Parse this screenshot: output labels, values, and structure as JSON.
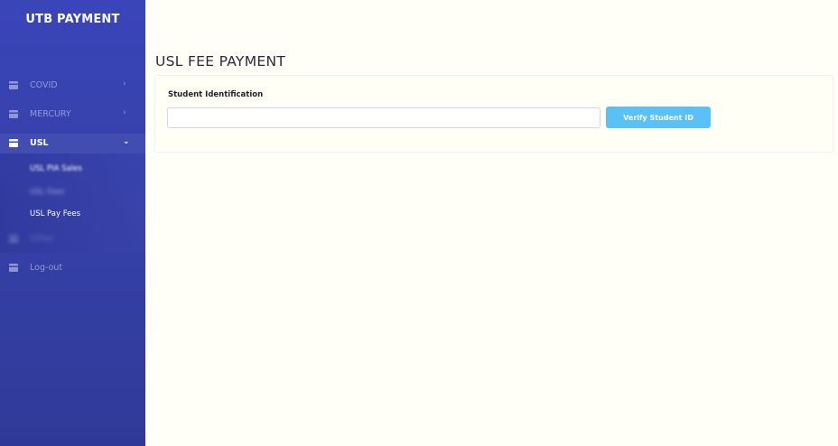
{
  "app": {
    "brand": "UTB PAYMENT"
  },
  "sidebar": {
    "items": [
      {
        "label": "COVID",
        "chevron": "›",
        "icon": "credit-card-icon"
      },
      {
        "label": "MERCURY",
        "chevron": "›",
        "icon": "credit-card-icon"
      },
      {
        "label": "USL",
        "chevron": "⌄",
        "icon": "credit-card-icon"
      },
      {
        "label": "Other",
        "icon": "credit-card-icon"
      },
      {
        "label": "Log-out",
        "icon": "credit-card-icon"
      }
    ],
    "submenu": [
      {
        "label": "USL PIA Sales"
      },
      {
        "label": "USL Fees"
      },
      {
        "label": "USL Pay Fees"
      }
    ]
  },
  "main": {
    "title": "USL FEE PAYMENT",
    "form": {
      "label": "Student Identification",
      "input_value": "",
      "button_label": "Verify Student ID"
    }
  },
  "colors": {
    "sidebar": "#3540a6",
    "accent_button": "#59c1f5",
    "page_bg": "#fffff7"
  }
}
